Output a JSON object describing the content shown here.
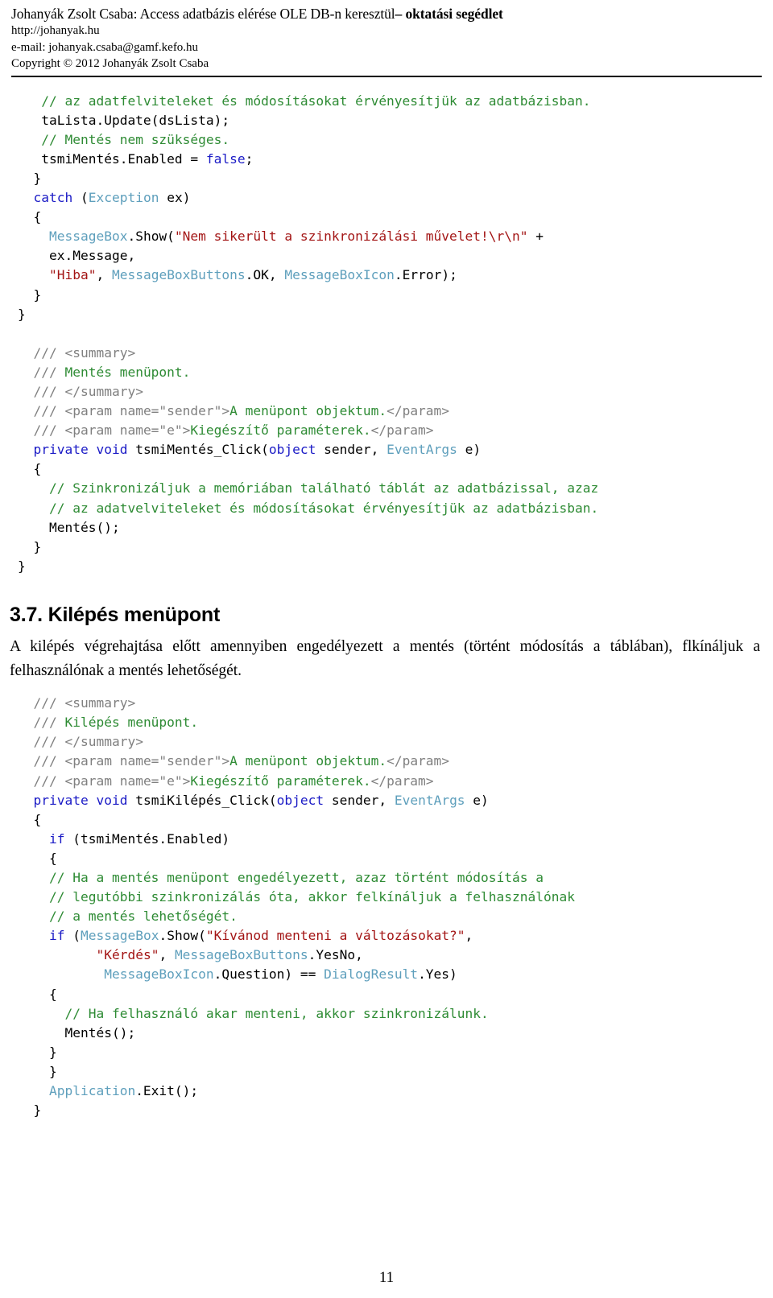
{
  "header": {
    "title_normal": "Johanyák Zsolt Csaba: Access adatbázis elérése OLE DB-n keresztül",
    "title_bold": "– oktatási segédlet",
    "url": "http://johanyak.hu",
    "email": "e-mail: johanyak.csaba@gamf.kefo.hu",
    "copyright": "Copyright © 2012 Johanyák Zsolt Csaba"
  },
  "colors": {
    "comment": "#2E8B34",
    "xml_doc_tag": "#808080",
    "keyword": "#1B1BC6",
    "type": "#5E9FBC",
    "string": "#A31515",
    "plain": "#000000"
  },
  "code_block_1": {
    "lines": [
      [
        {
          "t": "   ",
          "c": "pl"
        },
        {
          "t": "// az adatfelviteleket és módosításokat érvényesítjük az adatbázisban.",
          "c": "cm"
        }
      ],
      [
        {
          "t": "   taLista.Update(dsLista);",
          "c": "pl"
        }
      ],
      [
        {
          "t": "   ",
          "c": "pl"
        },
        {
          "t": "// Mentés nem szükséges.",
          "c": "cm"
        }
      ],
      [
        {
          "t": "   tsmiMentés.Enabled = ",
          "c": "pl"
        },
        {
          "t": "false",
          "c": "kw"
        },
        {
          "t": ";",
          "c": "pl"
        }
      ],
      [
        {
          "t": "  }",
          "c": "pl"
        }
      ],
      [
        {
          "t": "  ",
          "c": "pl"
        },
        {
          "t": "catch",
          "c": "kw"
        },
        {
          "t": " (",
          "c": "pl"
        },
        {
          "t": "Exception",
          "c": "ty"
        },
        {
          "t": " ex)",
          "c": "pl"
        }
      ],
      [
        {
          "t": "  {",
          "c": "pl"
        }
      ],
      [
        {
          "t": "    ",
          "c": "pl"
        },
        {
          "t": "MessageBox",
          "c": "ty"
        },
        {
          "t": ".Show(",
          "c": "pl"
        },
        {
          "t": "\"Nem sikerült a szinkronizálási művelet!\\r\\n\"",
          "c": "st"
        },
        {
          "t": " +",
          "c": "pl"
        }
      ],
      [
        {
          "t": "    ex.Message,",
          "c": "pl"
        }
      ],
      [
        {
          "t": "    ",
          "c": "pl"
        },
        {
          "t": "\"Hiba\"",
          "c": "st"
        },
        {
          "t": ", ",
          "c": "pl"
        },
        {
          "t": "MessageBoxButtons",
          "c": "ty"
        },
        {
          "t": ".OK, ",
          "c": "pl"
        },
        {
          "t": "MessageBoxIcon",
          "c": "ty"
        },
        {
          "t": ".Error);",
          "c": "pl"
        }
      ],
      [
        {
          "t": "  }",
          "c": "pl"
        }
      ],
      [
        {
          "t": "}",
          "c": "pl"
        }
      ],
      [
        {
          "t": "",
          "c": "pl"
        }
      ],
      [
        {
          "t": "  ",
          "c": "pl"
        },
        {
          "t": "/// <summary>",
          "c": "xd"
        }
      ],
      [
        {
          "t": "  ",
          "c": "pl"
        },
        {
          "t": "/// ",
          "c": "xd"
        },
        {
          "t": "Mentés menüpont.",
          "c": "xt"
        }
      ],
      [
        {
          "t": "  ",
          "c": "pl"
        },
        {
          "t": "/// </summary>",
          "c": "xd"
        }
      ],
      [
        {
          "t": "  ",
          "c": "pl"
        },
        {
          "t": "/// <param name=\"sender\">",
          "c": "xd"
        },
        {
          "t": "A menüpont objektum.",
          "c": "xt"
        },
        {
          "t": "</param>",
          "c": "xd"
        }
      ],
      [
        {
          "t": "  ",
          "c": "pl"
        },
        {
          "t": "/// <param name=\"e\">",
          "c": "xd"
        },
        {
          "t": "Kiegészítő paraméterek.",
          "c": "xt"
        },
        {
          "t": "</param>",
          "c": "xd"
        }
      ],
      [
        {
          "t": "  ",
          "c": "pl"
        },
        {
          "t": "private",
          "c": "kw"
        },
        {
          "t": " ",
          "c": "pl"
        },
        {
          "t": "void",
          "c": "kw"
        },
        {
          "t": " tsmiMentés_Click(",
          "c": "pl"
        },
        {
          "t": "object",
          "c": "kw"
        },
        {
          "t": " sender, ",
          "c": "pl"
        },
        {
          "t": "EventArgs",
          "c": "ty"
        },
        {
          "t": " e)",
          "c": "pl"
        }
      ],
      [
        {
          "t": "  {",
          "c": "pl"
        }
      ],
      [
        {
          "t": "    ",
          "c": "pl"
        },
        {
          "t": "// Szinkronizáljuk a memóriában található táblát az adatbázissal, azaz",
          "c": "cm"
        }
      ],
      [
        {
          "t": "    ",
          "c": "pl"
        },
        {
          "t": "// az adatvelviteleket és módosításokat érvényesítjük az adatbázisban.",
          "c": "cm"
        }
      ],
      [
        {
          "t": "    Mentés();",
          "c": "pl"
        }
      ],
      [
        {
          "t": "  }",
          "c": "pl"
        }
      ],
      [
        {
          "t": "}",
          "c": "pl"
        }
      ]
    ]
  },
  "section": {
    "number": "3.7.",
    "heading": "3.7. Kilépés menüpont",
    "paragraph": "A kilépés végrehajtása előtt amennyiben engedélyezett a mentés (történt módosítás a táblában), flkínáljuk a felhasználónak a mentés lehetőségét."
  },
  "code_block_2": {
    "lines": [
      [
        {
          "t": "  ",
          "c": "pl"
        },
        {
          "t": "/// <summary>",
          "c": "xd"
        }
      ],
      [
        {
          "t": "  ",
          "c": "pl"
        },
        {
          "t": "/// ",
          "c": "xd"
        },
        {
          "t": "Kilépés menüpont.",
          "c": "xt"
        }
      ],
      [
        {
          "t": "  ",
          "c": "pl"
        },
        {
          "t": "/// </summary>",
          "c": "xd"
        }
      ],
      [
        {
          "t": "  ",
          "c": "pl"
        },
        {
          "t": "/// <param name=\"sender\">",
          "c": "xd"
        },
        {
          "t": "A menüpont objektum.",
          "c": "xt"
        },
        {
          "t": "</param>",
          "c": "xd"
        }
      ],
      [
        {
          "t": "  ",
          "c": "pl"
        },
        {
          "t": "/// <param name=\"e\">",
          "c": "xd"
        },
        {
          "t": "Kiegészítő paraméterek.",
          "c": "xt"
        },
        {
          "t": "</param>",
          "c": "xd"
        }
      ],
      [
        {
          "t": "  ",
          "c": "pl"
        },
        {
          "t": "private",
          "c": "kw"
        },
        {
          "t": " ",
          "c": "pl"
        },
        {
          "t": "void",
          "c": "kw"
        },
        {
          "t": " tsmiKilépés_Click(",
          "c": "pl"
        },
        {
          "t": "object",
          "c": "kw"
        },
        {
          "t": " sender, ",
          "c": "pl"
        },
        {
          "t": "EventArgs",
          "c": "ty"
        },
        {
          "t": " e)",
          "c": "pl"
        }
      ],
      [
        {
          "t": "  {",
          "c": "pl"
        }
      ],
      [
        {
          "t": "    ",
          "c": "pl"
        },
        {
          "t": "if",
          "c": "kw"
        },
        {
          "t": " (tsmiMentés.Enabled)",
          "c": "pl"
        }
      ],
      [
        {
          "t": "    {",
          "c": "pl"
        }
      ],
      [
        {
          "t": "    ",
          "c": "pl"
        },
        {
          "t": "// Ha a mentés menüpont engedélyezett, azaz történt módosítás a",
          "c": "cm"
        }
      ],
      [
        {
          "t": "    ",
          "c": "pl"
        },
        {
          "t": "// legutóbbi szinkronizálás óta, akkor felkínáljuk a felhasználónak",
          "c": "cm"
        }
      ],
      [
        {
          "t": "    ",
          "c": "pl"
        },
        {
          "t": "// a mentés lehetőségét.",
          "c": "cm"
        }
      ],
      [
        {
          "t": "    ",
          "c": "pl"
        },
        {
          "t": "if",
          "c": "kw"
        },
        {
          "t": " (",
          "c": "pl"
        },
        {
          "t": "MessageBox",
          "c": "ty"
        },
        {
          "t": ".Show(",
          "c": "pl"
        },
        {
          "t": "\"Kívánod menteni a változásokat?\"",
          "c": "st"
        },
        {
          "t": ",",
          "c": "pl"
        }
      ],
      [
        {
          "t": "          ",
          "c": "pl"
        },
        {
          "t": "\"Kérdés\"",
          "c": "st"
        },
        {
          "t": ", ",
          "c": "pl"
        },
        {
          "t": "MessageBoxButtons",
          "c": "ty"
        },
        {
          "t": ".YesNo,",
          "c": "pl"
        }
      ],
      [
        {
          "t": "           ",
          "c": "pl"
        },
        {
          "t": "MessageBoxIcon",
          "c": "ty"
        },
        {
          "t": ".Question) == ",
          "c": "pl"
        },
        {
          "t": "DialogResult",
          "c": "ty"
        },
        {
          "t": ".Yes)",
          "c": "pl"
        }
      ],
      [
        {
          "t": "    {",
          "c": "pl"
        }
      ],
      [
        {
          "t": "      ",
          "c": "pl"
        },
        {
          "t": "// Ha felhasználó akar menteni, akkor szinkronizálunk.",
          "c": "cm"
        }
      ],
      [
        {
          "t": "      Mentés();",
          "c": "pl"
        }
      ],
      [
        {
          "t": "    }",
          "c": "pl"
        }
      ],
      [
        {
          "t": "    }",
          "c": "pl"
        }
      ],
      [
        {
          "t": "    ",
          "c": "pl"
        },
        {
          "t": "Application",
          "c": "ty"
        },
        {
          "t": ".Exit();",
          "c": "pl"
        }
      ],
      [
        {
          "t": "  }",
          "c": "pl"
        }
      ]
    ]
  },
  "footer": {
    "page_number": "11"
  }
}
